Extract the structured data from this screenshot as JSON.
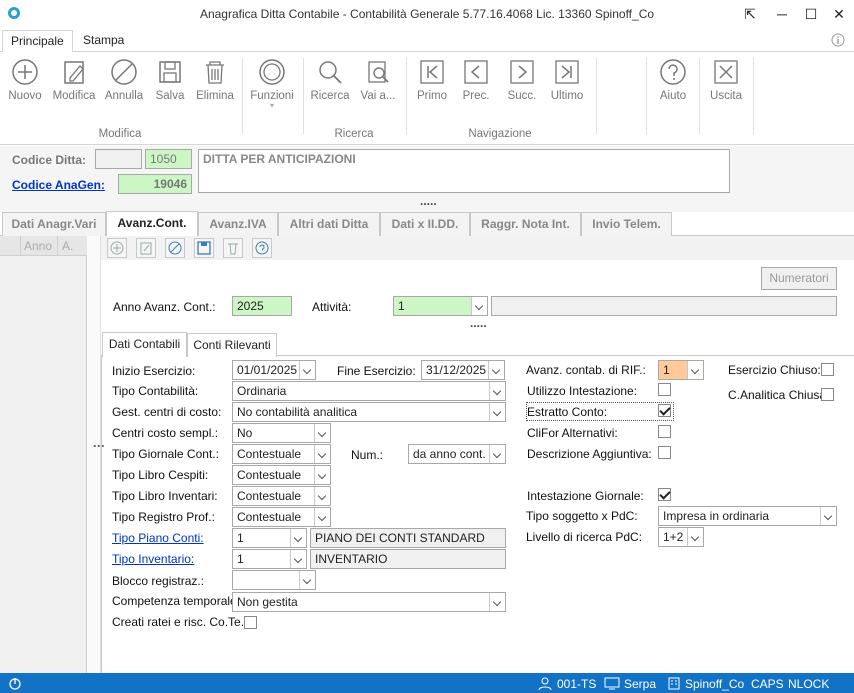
{
  "window": {
    "title": "Anagrafica Ditta Contabile - Contabilità Generale 5.77.16.4068 Lic. 13360 Spinoff_Co"
  },
  "ribbon_tabs": [
    "Principale",
    "Stampa"
  ],
  "ribbon": {
    "buttons": {
      "nuovo": "Nuovo",
      "modifica": "Modifica",
      "annulla": "Annulla",
      "salva": "Salva",
      "elimina": "Elimina",
      "funzioni": "Funzioni",
      "ricerca": "Ricerca",
      "vai": "Vai a...",
      "primo": "Primo",
      "prec": "Prec.",
      "succ": "Succ.",
      "ultimo": "Ultimo",
      "aiuto": "Aiuto",
      "uscita": "Uscita"
    },
    "groups": {
      "modifica": "Modifica",
      "ricerca": "Ricerca",
      "navigazione": "Navigazione"
    }
  },
  "header": {
    "codice_ditta_label": "Codice Ditta:",
    "codice_ditta_value": "1050",
    "codice_anagen_label": "Codice AnaGen:",
    "codice_anagen_value": "19046",
    "descrizione": "DITTA PER ANTICIPAZIONI",
    "dots": "....."
  },
  "main_tabs": [
    "Dati Anagr.Vari",
    "Avanz.Cont.",
    "Avanz.IVA",
    "Altri dati Ditta",
    "Dati x II.DD.",
    "Raggr. Nota Int.",
    "Invio Telem."
  ],
  "grid": {
    "col_anno": "Anno",
    "col_a": "A."
  },
  "numeratori_label": "Numeratori",
  "anno_avanz_label": "Anno Avanz. Cont.:",
  "anno_avanz_value": "2025",
  "attivita_label": "Attività:",
  "attivita_value": "1",
  "dots2": ".....",
  "sub_tabs": [
    "Dati Contabili",
    "Conti Rilevanti"
  ],
  "form": {
    "inizio_esercizio_label": "Inizio Esercizio:",
    "inizio_esercizio": "01/01/2025",
    "fine_esercizio_label": "Fine Esercizio:",
    "fine_esercizio": "31/12/2025",
    "tipo_contabilita_label": "Tipo Contabilità:",
    "tipo_contabilita": "Ordinaria",
    "gest_centri_label": "Gest. centri di costo:",
    "gest_centri": "No contabilità analitica",
    "centri_sempl_label": "Centri costo sempl.:",
    "centri_sempl": "No",
    "tipo_giornale_label": "Tipo Giornale Cont.:",
    "tipo_giornale": "Contestuale",
    "num_label": "Num.:",
    "num_value": "da anno cont.",
    "tipo_libro_cespiti_label": "Tipo Libro Cespiti:",
    "tipo_libro_cespiti": "Contestuale",
    "tipo_libro_inventari_label": "Tipo Libro Inventari:",
    "tipo_libro_inventari": "Contestuale",
    "tipo_registro_prof_label": "Tipo Registro Prof.:",
    "tipo_registro_prof": "Contestuale",
    "tipo_piano_conti_label": "Tipo Piano Conti:",
    "tipo_piano_conti": "1",
    "tipo_piano_conti_desc": "PIANO DEI CONTI STANDARD",
    "tipo_inventario_label": "Tipo Inventario:",
    "tipo_inventario": "1",
    "tipo_inventario_desc": "INVENTARIO",
    "blocco_label": "Blocco registraz.:",
    "blocco": "",
    "competenza_label": "Competenza temporale",
    "competenza": "Non gestita",
    "creati_ratei_label": "Creati ratei e risc. Co.Te.:",
    "avanz_rif_label": "Avanz. contab. di RIF.:",
    "avanz_rif": "1",
    "esercizio_chiuso_label": "Esercizio Chiuso:",
    "canalitica_chiusa_label": "C.Analitica Chiusa:",
    "utilizzo_intestazione_label": "Utilizzo Intestazione:",
    "estratto_conto_label": "Estratto Conto:",
    "clifor_alternativi_label": "CliFor Alternativi:",
    "descrizione_aggiuntiva_label": "Descrizione Aggiuntiva:",
    "intestazione_giornale_label": "Intestazione Giornale:",
    "tipo_soggetto_label": "Tipo soggetto x PdC:",
    "tipo_soggetto": "Impresa in ordinaria",
    "livello_ricerca_label": "Livello di ricerca PdC:",
    "livello_ricerca": "1+2"
  },
  "status": {
    "user": "001-TS",
    "host": "Serpa",
    "company": "Spinoff_Co",
    "caps": "CAPS",
    "nlock": "NLOCK"
  }
}
